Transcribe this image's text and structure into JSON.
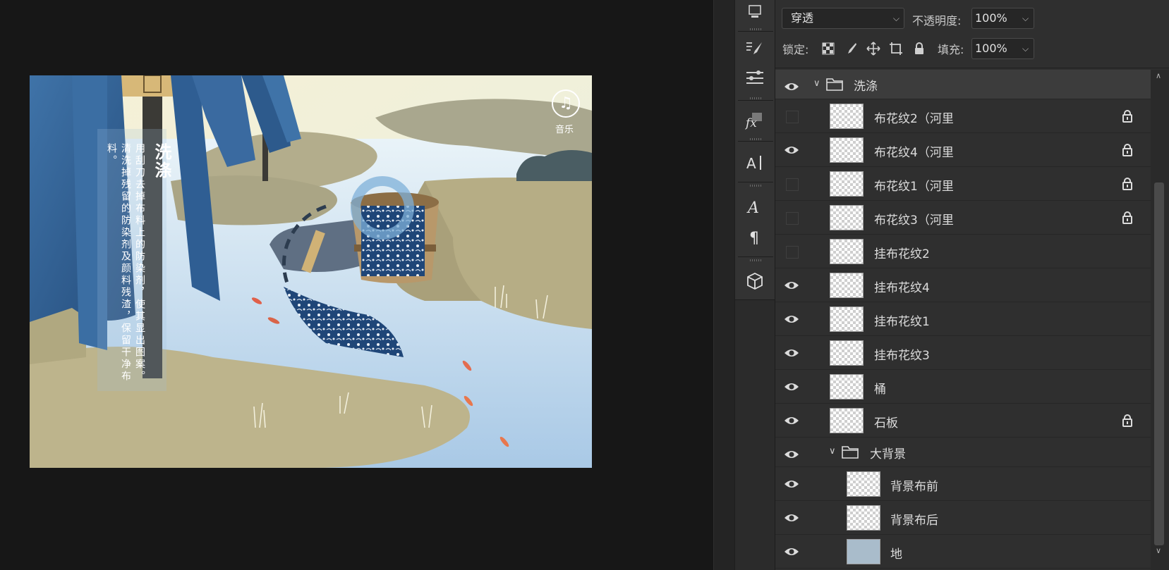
{
  "artwork": {
    "title": "洗涤",
    "body": "用刮刀去掉布料上的防染剂，使其显出图案。清洗掉残留的防染剂及颜料残渣，保留干净布料。",
    "music_label": "音乐",
    "music_glyph": "♫"
  },
  "layer_options": {
    "blend_mode": "穿透",
    "opacity_label": "不透明度:",
    "opacity_value": "100%",
    "lock_label": "锁定:",
    "fill_label": "填充:",
    "fill_value": "100%",
    "chevron": "⌵"
  },
  "layers": [
    {
      "name": "洗涤",
      "kind": "group",
      "visible": true,
      "expanded": true
    },
    {
      "name": "布花纹2（河里",
      "kind": "layer",
      "visible": false,
      "locked": true
    },
    {
      "name": "布花纹4（河里",
      "kind": "layer",
      "visible": true,
      "locked": true
    },
    {
      "name": "布花纹1（河里",
      "kind": "layer",
      "visible": false,
      "locked": true
    },
    {
      "name": "布花纹3（河里",
      "kind": "layer",
      "visible": false,
      "locked": true
    },
    {
      "name": "挂布花纹2",
      "kind": "layer",
      "visible": false,
      "locked": false
    },
    {
      "name": "挂布花纹4",
      "kind": "layer",
      "visible": true,
      "locked": false
    },
    {
      "name": "挂布花纹1",
      "kind": "layer",
      "visible": true,
      "locked": false
    },
    {
      "name": "挂布花纹3",
      "kind": "layer",
      "visible": true,
      "locked": false
    },
    {
      "name": "桶",
      "kind": "layer",
      "visible": true,
      "locked": false
    },
    {
      "name": "石板",
      "kind": "layer",
      "visible": true,
      "locked": true
    },
    {
      "name": "大背景",
      "kind": "group",
      "visible": true,
      "expanded": true
    },
    {
      "name": "背景布前",
      "kind": "layer",
      "visible": true,
      "locked": false
    },
    {
      "name": "背景布后",
      "kind": "layer",
      "visible": true,
      "locked": false
    },
    {
      "name": "地",
      "kind": "layer",
      "visible": true,
      "locked": false
    }
  ],
  "colors": {
    "panel_bg": "#2f2f2f",
    "canvas_bg": "#171717",
    "indigo": "#2d5b8c",
    "water": "#cfe2f0",
    "land": "#b8ae86"
  }
}
